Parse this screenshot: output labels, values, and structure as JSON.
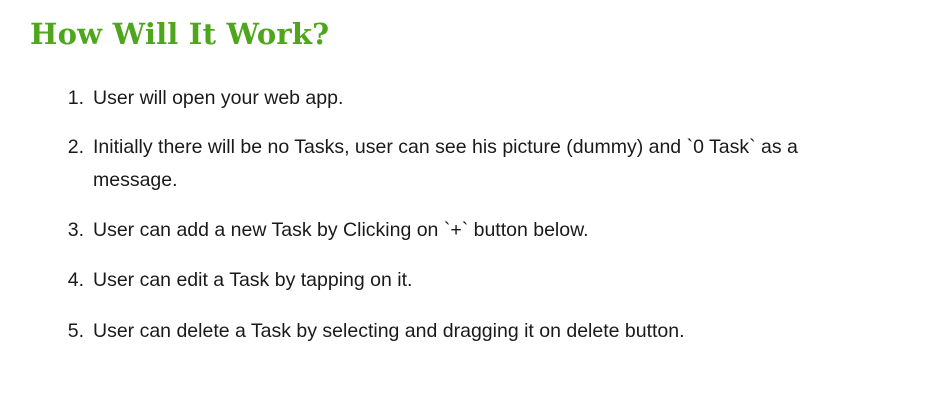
{
  "document": {
    "heading": "How Will It Work?",
    "accent_color": "#4fa61c",
    "steps": [
      {
        "number": "1.",
        "text": "User will open your web app."
      },
      {
        "number": "2.",
        "text": "Initially there will be no Tasks, user can see his picture (dummy) and `0 Task` as a message."
      },
      {
        "number": "3.",
        "text": "User can add a new Task by Clicking on `+` button below."
      },
      {
        "number": "4.",
        "text": "User can edit a Task by tapping on it."
      },
      {
        "number": "5.",
        "text": "User can delete a Task by selecting and dragging it on delete button."
      }
    ]
  }
}
